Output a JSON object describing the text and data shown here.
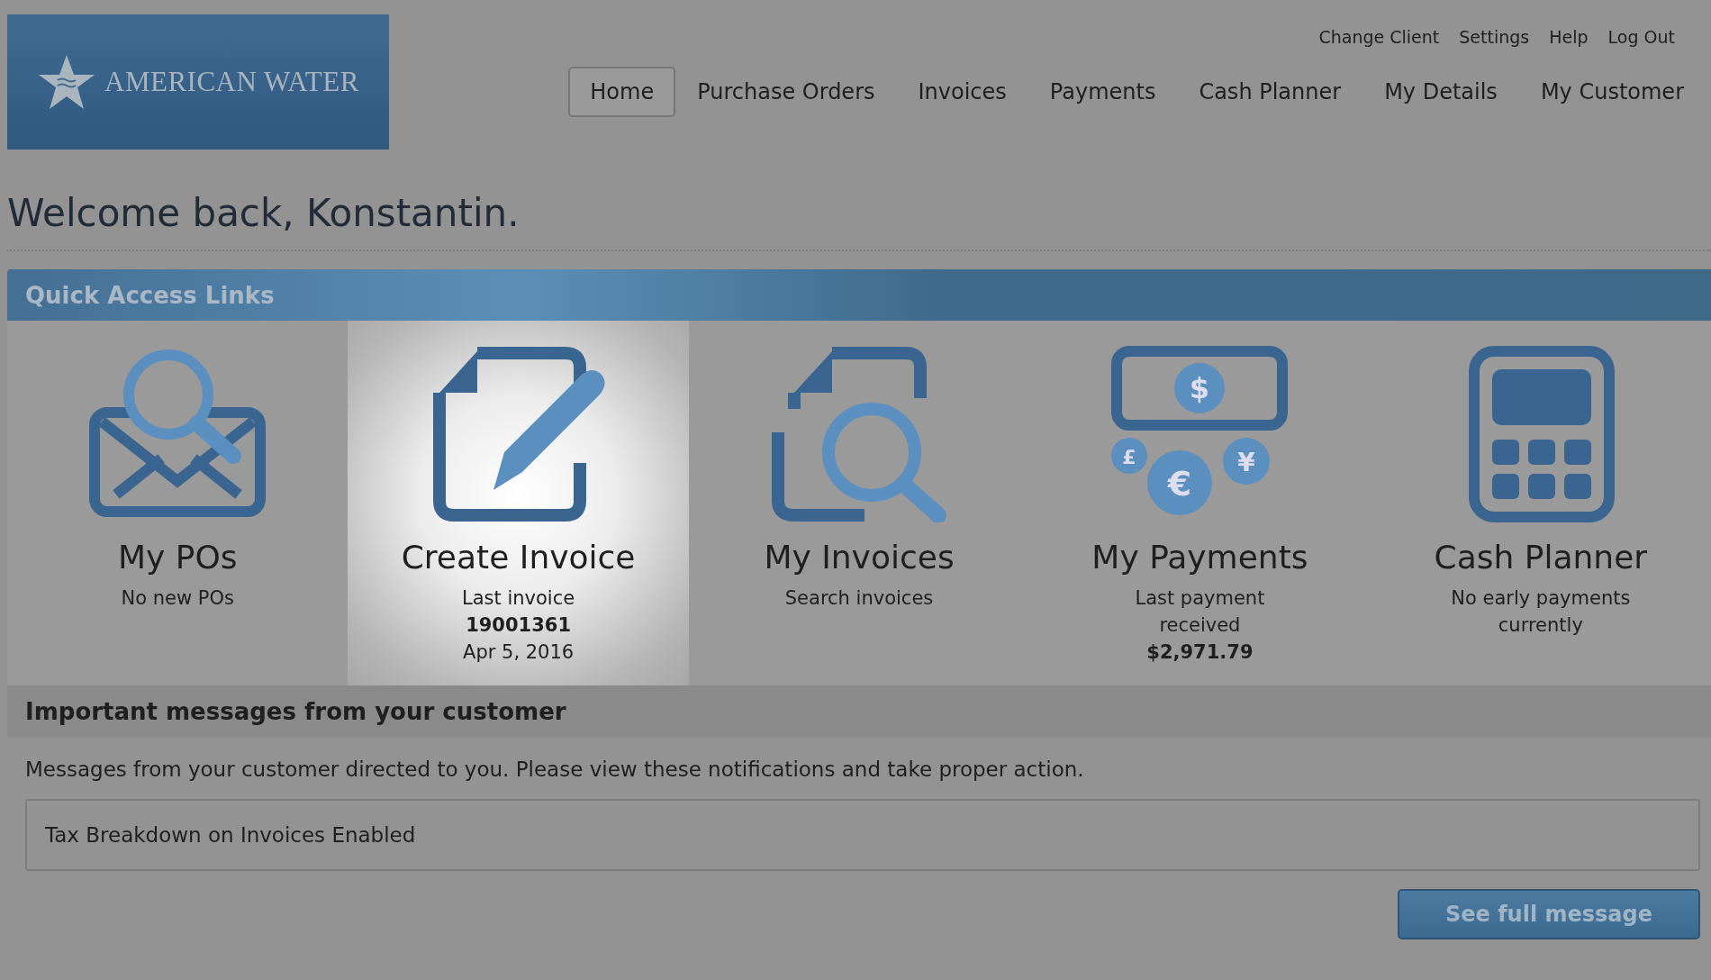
{
  "logo": {
    "text": "AMERICAN WATER"
  },
  "top_links": [
    "Change Client",
    "Settings",
    "Help",
    "Log Out"
  ],
  "nav": [
    {
      "label": "Home",
      "selected": true
    },
    {
      "label": "Purchase Orders",
      "selected": false
    },
    {
      "label": "Invoices",
      "selected": false
    },
    {
      "label": "Payments",
      "selected": false
    },
    {
      "label": "Cash Planner",
      "selected": false
    },
    {
      "label": "My Details",
      "selected": false
    },
    {
      "label": "My Customer",
      "selected": false
    }
  ],
  "heading": "Welcome back, Konstantin.",
  "quick_links": {
    "title": "Quick Access Links",
    "tiles": [
      {
        "kind": "pos",
        "title": "My POs",
        "caption": "No new POs",
        "highlighted": false
      },
      {
        "kind": "create",
        "title": "Create Invoice",
        "caption": "Last invoice\n**19001361**\nApr 5, 2016",
        "highlighted": true
      },
      {
        "kind": "search",
        "title": "My Invoices",
        "caption": "Search invoices",
        "highlighted": false
      },
      {
        "kind": "payments",
        "title": "My Payments",
        "caption": "Last payment received\n**$2,971.79**",
        "highlighted": false,
        "icon_symbols": [
          "$",
          "£",
          "€",
          "¥"
        ]
      },
      {
        "kind": "calculator",
        "title": "Cash Planner",
        "caption": "No early payments currently",
        "highlighted": false
      }
    ]
  },
  "messages": {
    "title": "Important messages from your customer",
    "intro": "Messages from your customer directed to you. Please view these notifications and take proper action.",
    "items": [
      "Tax Breakdown on Invoices Enabled"
    ],
    "button": "See full message"
  }
}
